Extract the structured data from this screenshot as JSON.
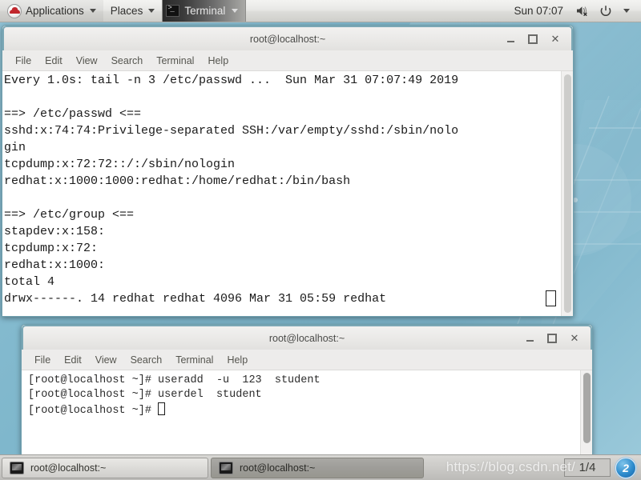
{
  "top_panel": {
    "applications_label": "Applications",
    "places_label": "Places",
    "window_menu_label": "Terminal",
    "clock": "Sun 07:07",
    "icons": {
      "logo": "redhat-logo-icon",
      "terminal": "terminal-icon",
      "volume": "volume-muted-icon",
      "power": "power-icon",
      "caret": "chevron-down-icon"
    }
  },
  "window_one": {
    "title": "root@localhost:~",
    "menus": [
      "File",
      "Edit",
      "View",
      "Search",
      "Terminal",
      "Help"
    ],
    "buttons": {
      "minimize": "_",
      "maximize": "□",
      "close": "✕"
    },
    "lines": [
      "Every 1.0s: tail -n 3 /etc/passwd ...  Sun Mar 31 07:07:49 2019",
      "",
      "==> /etc/passwd <==",
      "sshd:x:74:74:Privilege-separated SSH:/var/empty/sshd:/sbin/nolo",
      "gin",
      "tcpdump:x:72:72::/:/sbin/nologin",
      "redhat:x:1000:1000:redhat:/home/redhat:/bin/bash",
      "",
      "==> /etc/group <==",
      "stapdev:x:158:",
      "tcpdump:x:72:",
      "redhat:x:1000:",
      "total 4",
      "drwx------. 14 redhat redhat 4096 Mar 31 05:59 redhat"
    ]
  },
  "window_two": {
    "title": "root@localhost:~",
    "menus": [
      "File",
      "Edit",
      "View",
      "Search",
      "Terminal",
      "Help"
    ],
    "buttons": {
      "minimize": "_",
      "maximize": "□",
      "close": "✕"
    },
    "lines": [
      "[root@localhost ~]# useradd  -u  123  student",
      "[root@localhost ~]# userdel  student"
    ],
    "prompt": "[root@localhost ~]# "
  },
  "taskbar": {
    "tasks": [
      {
        "label": "root@localhost:~",
        "active": false
      },
      {
        "label": "root@localhost:~",
        "active": true
      }
    ],
    "workspace": "1/4",
    "workspace_logo": "2"
  },
  "watermark": "https://blog.csdn.net/",
  "colors": {
    "desktop": "#7fb7cc",
    "window_frame": "#7ba7b5",
    "panel": "#e8e8e6",
    "terminal_bg": "#ffffff",
    "terminal_fg": "#1a1a1a",
    "taskbar_active": "#9e9d99",
    "accent_blue": "#2e8ccd",
    "redhat_red": "#c1272d"
  }
}
